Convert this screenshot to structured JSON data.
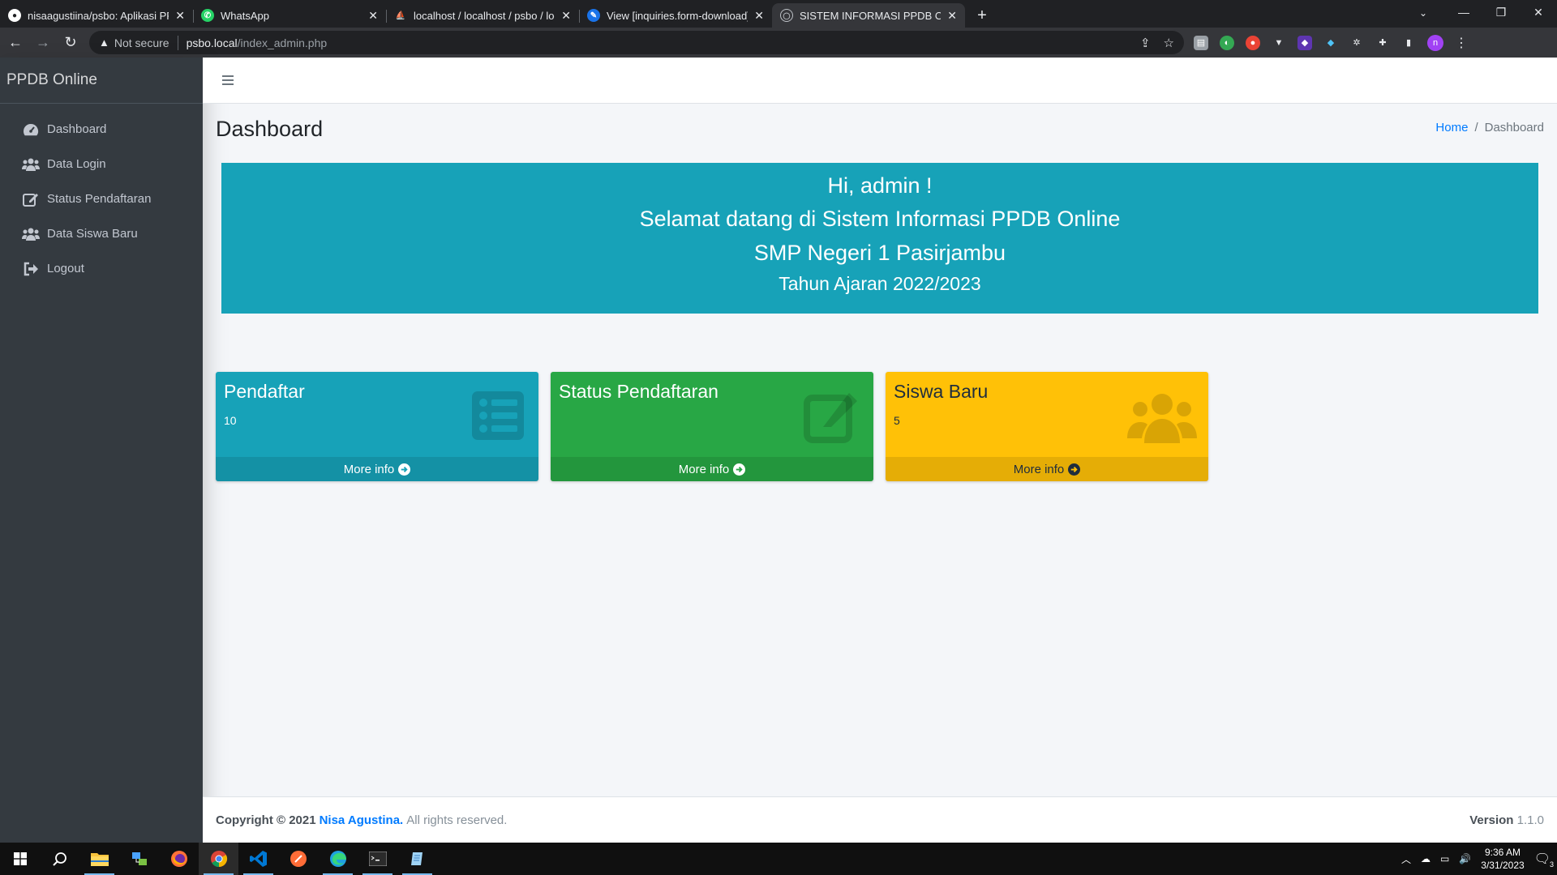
{
  "browser": {
    "tabs": [
      {
        "title": "nisaagustiina/psbo: Aplikasi PPDB",
        "icon": "github-icon"
      },
      {
        "title": "WhatsApp",
        "icon": "whatsapp-icon"
      },
      {
        "title": "localhost / localhost / psbo / login",
        "icon": "phpmyadmin-icon"
      },
      {
        "title": "View [inquiries.form-download]",
        "icon": "edit-icon"
      },
      {
        "title": "SISTEM INFORMASI PPDB ONLINE",
        "icon": "globe-icon"
      }
    ],
    "address": {
      "security": "Not secure",
      "host": "psbo.local",
      "path": "/index_admin.php"
    }
  },
  "sidebar": {
    "brand": "PPDB Online",
    "items": [
      {
        "label": "Dashboard",
        "icon": "tachometer-icon"
      },
      {
        "label": "Data Login",
        "icon": "users-icon"
      },
      {
        "label": "Status Pendaftaran",
        "icon": "edit-icon"
      },
      {
        "label": "Data Siswa Baru",
        "icon": "users-icon"
      },
      {
        "label": "Logout",
        "icon": "sign-out-icon"
      }
    ]
  },
  "header": {
    "title": "Dashboard",
    "breadcrumb": {
      "home": "Home",
      "separator": "/",
      "current": "Dashboard"
    }
  },
  "welcome": {
    "greeting": "Hi, admin !",
    "line2": "Selamat datang di Sistem Informasi PPDB Online",
    "line3": "SMP Negeri 1 Pasirjambu",
    "line4": "Tahun Ajaran 2022/2023",
    "color": "#17a2b8"
  },
  "boxes": [
    {
      "title": "Pendaftar",
      "count": "10",
      "more": "More info",
      "color": "#17a2b8",
      "icon": "list-icon"
    },
    {
      "title": "Status Pendaftaran",
      "count": "",
      "more": "More info",
      "color": "#28a745",
      "icon": "edit-icon"
    },
    {
      "title": "Siswa Baru",
      "count": "5",
      "more": "More info",
      "color": "#ffc107",
      "icon": "users-icon"
    }
  ],
  "footer": {
    "copyright": "Copyright © 2021",
    "author": "Nisa Agustina.",
    "rights": "All rights reserved.",
    "version_label": "Version",
    "version": "1.1.0"
  },
  "taskbar": {
    "time": "9:36 AM",
    "date": "3/31/2023",
    "notifications": "3"
  }
}
